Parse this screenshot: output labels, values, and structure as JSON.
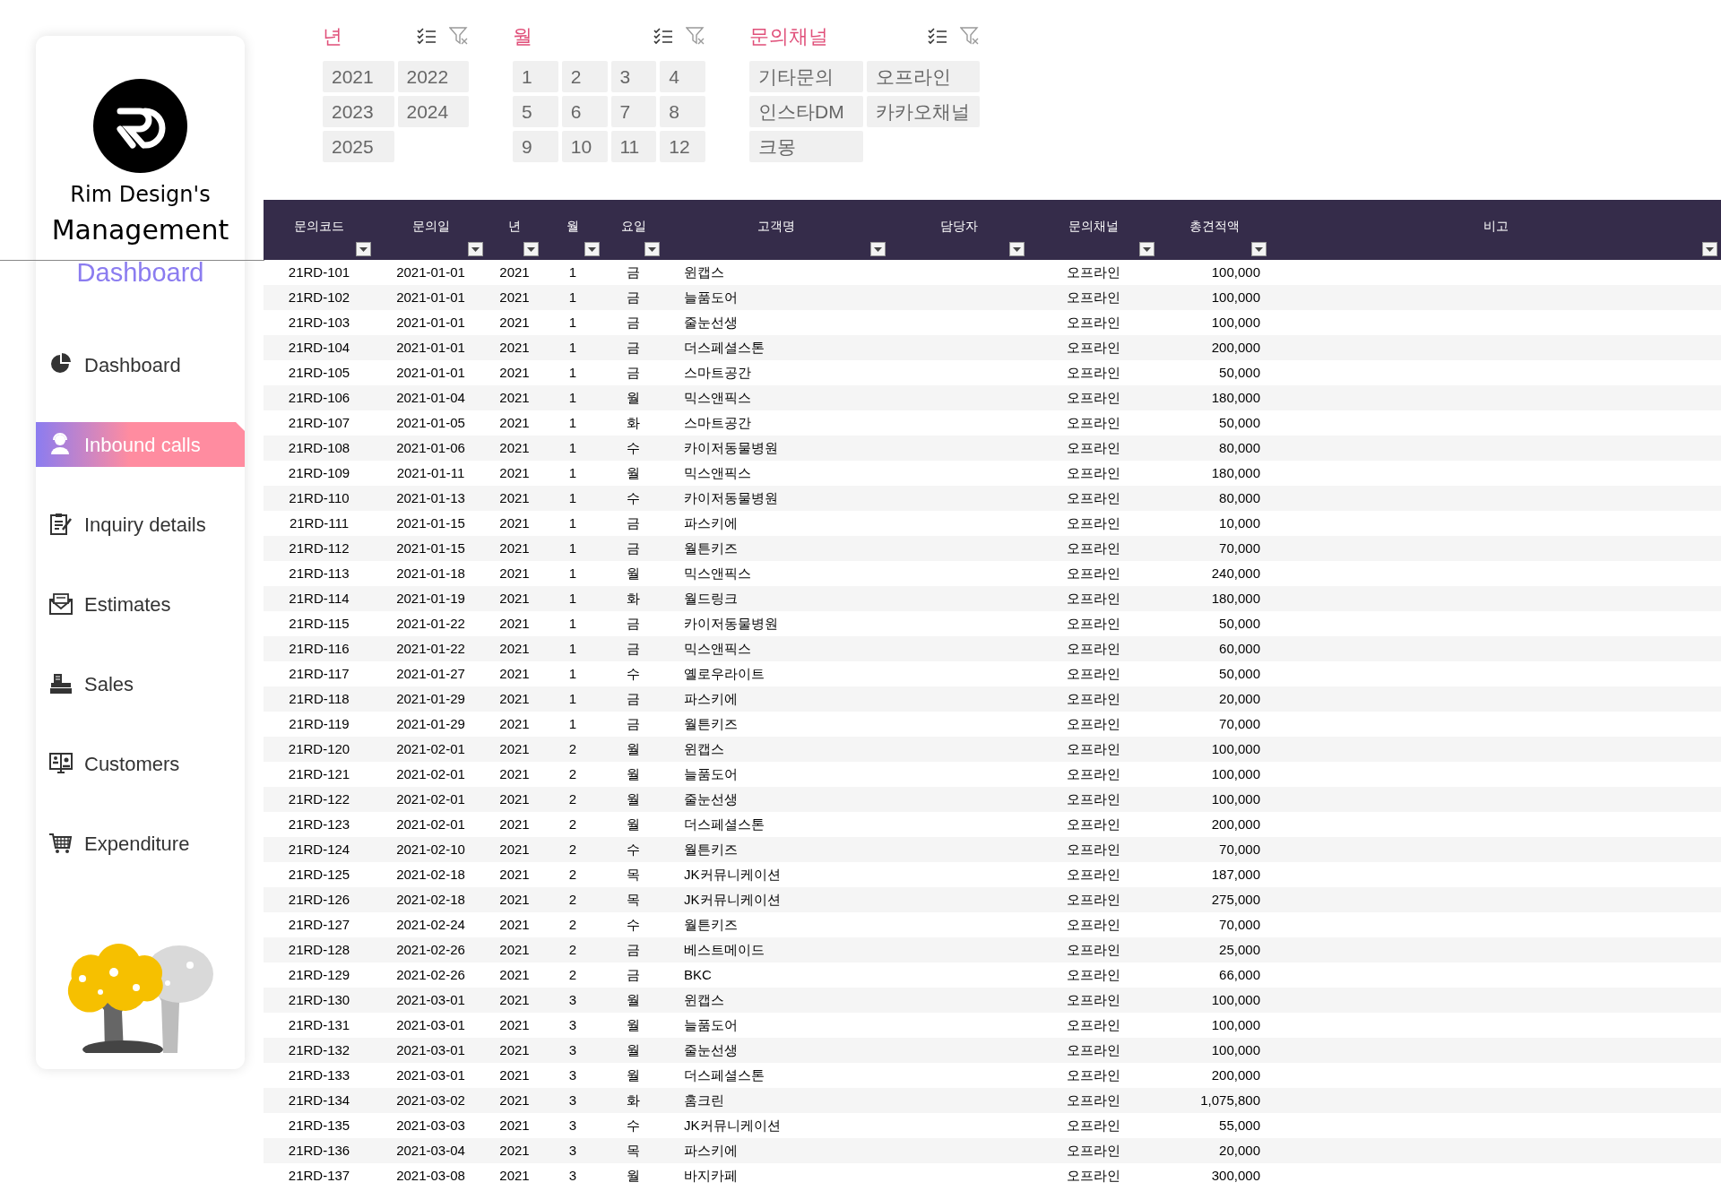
{
  "sidebar": {
    "brand": {
      "line1": "Rim Design's",
      "line2": "Management",
      "line3": "Dashboard"
    },
    "nav": [
      {
        "label": "Dashboard",
        "selected": false
      },
      {
        "label": "Inbound calls",
        "selected": true
      },
      {
        "label": "Inquiry details",
        "selected": false
      },
      {
        "label": "Estimates",
        "selected": false
      },
      {
        "label": "Sales",
        "selected": false
      },
      {
        "label": "Customers",
        "selected": false
      },
      {
        "label": "Expenditure",
        "selected": false
      }
    ]
  },
  "slicers": [
    {
      "title": "년",
      "items": [
        {
          "label": "2021",
          "selected": false
        },
        {
          "label": "2022",
          "selected": false
        },
        {
          "label": "2023",
          "selected": false
        },
        {
          "label": "2024",
          "selected": false
        },
        {
          "label": "2025",
          "selected": false
        }
      ]
    },
    {
      "title": "월",
      "items": [
        {
          "label": "1",
          "selected": false
        },
        {
          "label": "2",
          "selected": false
        },
        {
          "label": "3",
          "selected": false
        },
        {
          "label": "4",
          "selected": false
        },
        {
          "label": "5",
          "selected": false
        },
        {
          "label": "6",
          "selected": false
        },
        {
          "label": "7",
          "selected": false
        },
        {
          "label": "8",
          "selected": false
        },
        {
          "label": "9",
          "selected": false
        },
        {
          "label": "10",
          "selected": false
        },
        {
          "label": "11",
          "selected": false
        },
        {
          "label": "12",
          "selected": false
        }
      ]
    },
    {
      "title": "문의채널",
      "items": [
        {
          "label": "기타문의",
          "selected": false
        },
        {
          "label": "오프라인",
          "selected": false
        },
        {
          "label": "인스타DM",
          "selected": false
        },
        {
          "label": "카카오채널",
          "selected": false
        },
        {
          "label": "크몽",
          "selected": false
        }
      ]
    }
  ],
  "table": {
    "columns": [
      "문의코드",
      "문의일",
      "년",
      "월",
      "요일",
      "고객명",
      "담당자",
      "문의채널",
      "총견적액",
      "비고"
    ],
    "rows": [
      {
        "code": "21RD-101",
        "date": "2021-01-01",
        "year": "2021",
        "month": "1",
        "weekday": "금",
        "customer": "윈캡스",
        "channel": "오프라인",
        "amount": "100,000"
      },
      {
        "code": "21RD-102",
        "date": "2021-01-01",
        "year": "2021",
        "month": "1",
        "weekday": "금",
        "customer": "늘품도어",
        "channel": "오프라인",
        "amount": "100,000"
      },
      {
        "code": "21RD-103",
        "date": "2021-01-01",
        "year": "2021",
        "month": "1",
        "weekday": "금",
        "customer": "줄눈선생",
        "channel": "오프라인",
        "amount": "100,000"
      },
      {
        "code": "21RD-104",
        "date": "2021-01-01",
        "year": "2021",
        "month": "1",
        "weekday": "금",
        "customer": "더스페셜스톤",
        "channel": "오프라인",
        "amount": "200,000"
      },
      {
        "code": "21RD-105",
        "date": "2021-01-01",
        "year": "2021",
        "month": "1",
        "weekday": "금",
        "customer": "스마트공간",
        "channel": "오프라인",
        "amount": "50,000"
      },
      {
        "code": "21RD-106",
        "date": "2021-01-04",
        "year": "2021",
        "month": "1",
        "weekday": "월",
        "customer": "믹스앤픽스",
        "channel": "오프라인",
        "amount": "180,000"
      },
      {
        "code": "21RD-107",
        "date": "2021-01-05",
        "year": "2021",
        "month": "1",
        "weekday": "화",
        "customer": "스마트공간",
        "channel": "오프라인",
        "amount": "50,000"
      },
      {
        "code": "21RD-108",
        "date": "2021-01-06",
        "year": "2021",
        "month": "1",
        "weekday": "수",
        "customer": "카이저동물병원",
        "channel": "오프라인",
        "amount": "80,000"
      },
      {
        "code": "21RD-109",
        "date": "2021-01-11",
        "year": "2021",
        "month": "1",
        "weekday": "월",
        "customer": "믹스앤픽스",
        "channel": "오프라인",
        "amount": "180,000"
      },
      {
        "code": "21RD-110",
        "date": "2021-01-13",
        "year": "2021",
        "month": "1",
        "weekday": "수",
        "customer": "카이저동물병원",
        "channel": "오프라인",
        "amount": "80,000"
      },
      {
        "code": "21RD-111",
        "date": "2021-01-15",
        "year": "2021",
        "month": "1",
        "weekday": "금",
        "customer": "파스키에",
        "channel": "오프라인",
        "amount": "10,000"
      },
      {
        "code": "21RD-112",
        "date": "2021-01-15",
        "year": "2021",
        "month": "1",
        "weekday": "금",
        "customer": "월튼키즈",
        "channel": "오프라인",
        "amount": "70,000"
      },
      {
        "code": "21RD-113",
        "date": "2021-01-18",
        "year": "2021",
        "month": "1",
        "weekday": "월",
        "customer": "믹스앤픽스",
        "channel": "오프라인",
        "amount": "240,000"
      },
      {
        "code": "21RD-114",
        "date": "2021-01-19",
        "year": "2021",
        "month": "1",
        "weekday": "화",
        "customer": "월드링크",
        "channel": "오프라인",
        "amount": "180,000"
      },
      {
        "code": "21RD-115",
        "date": "2021-01-22",
        "year": "2021",
        "month": "1",
        "weekday": "금",
        "customer": "카이저동물병원",
        "channel": "오프라인",
        "amount": "50,000"
      },
      {
        "code": "21RD-116",
        "date": "2021-01-22",
        "year": "2021",
        "month": "1",
        "weekday": "금",
        "customer": "믹스앤픽스",
        "channel": "오프라인",
        "amount": "60,000"
      },
      {
        "code": "21RD-117",
        "date": "2021-01-27",
        "year": "2021",
        "month": "1",
        "weekday": "수",
        "customer": "옐로우라이트",
        "channel": "오프라인",
        "amount": "50,000"
      },
      {
        "code": "21RD-118",
        "date": "2021-01-29",
        "year": "2021",
        "month": "1",
        "weekday": "금",
        "customer": "파스키에",
        "channel": "오프라인",
        "amount": "20,000"
      },
      {
        "code": "21RD-119",
        "date": "2021-01-29",
        "year": "2021",
        "month": "1",
        "weekday": "금",
        "customer": "월튼키즈",
        "channel": "오프라인",
        "amount": "70,000"
      },
      {
        "code": "21RD-120",
        "date": "2021-02-01",
        "year": "2021",
        "month": "2",
        "weekday": "월",
        "customer": "윈캡스",
        "channel": "오프라인",
        "amount": "100,000"
      },
      {
        "code": "21RD-121",
        "date": "2021-02-01",
        "year": "2021",
        "month": "2",
        "weekday": "월",
        "customer": "늘품도어",
        "channel": "오프라인",
        "amount": "100,000"
      },
      {
        "code": "21RD-122",
        "date": "2021-02-01",
        "year": "2021",
        "month": "2",
        "weekday": "월",
        "customer": "줄눈선생",
        "channel": "오프라인",
        "amount": "100,000"
      },
      {
        "code": "21RD-123",
        "date": "2021-02-01",
        "year": "2021",
        "month": "2",
        "weekday": "월",
        "customer": "더스페셜스톤",
        "channel": "오프라인",
        "amount": "200,000"
      },
      {
        "code": "21RD-124",
        "date": "2021-02-10",
        "year": "2021",
        "month": "2",
        "weekday": "수",
        "customer": "월튼키즈",
        "channel": "오프라인",
        "amount": "70,000"
      },
      {
        "code": "21RD-125",
        "date": "2021-02-18",
        "year": "2021",
        "month": "2",
        "weekday": "목",
        "customer": "JK커뮤니케이션",
        "channel": "오프라인",
        "amount": "187,000"
      },
      {
        "code": "21RD-126",
        "date": "2021-02-18",
        "year": "2021",
        "month": "2",
        "weekday": "목",
        "customer": "JK커뮤니케이션",
        "channel": "오프라인",
        "amount": "275,000"
      },
      {
        "code": "21RD-127",
        "date": "2021-02-24",
        "year": "2021",
        "month": "2",
        "weekday": "수",
        "customer": "월튼키즈",
        "channel": "오프라인",
        "amount": "70,000"
      },
      {
        "code": "21RD-128",
        "date": "2021-02-26",
        "year": "2021",
        "month": "2",
        "weekday": "금",
        "customer": "베스트메이드",
        "channel": "오프라인",
        "amount": "25,000"
      },
      {
        "code": "21RD-129",
        "date": "2021-02-26",
        "year": "2021",
        "month": "2",
        "weekday": "금",
        "customer": "BKC",
        "channel": "오프라인",
        "amount": "66,000"
      },
      {
        "code": "21RD-130",
        "date": "2021-03-01",
        "year": "2021",
        "month": "3",
        "weekday": "월",
        "customer": "윈캡스",
        "channel": "오프라인",
        "amount": "100,000"
      },
      {
        "code": "21RD-131",
        "date": "2021-03-01",
        "year": "2021",
        "month": "3",
        "weekday": "월",
        "customer": "늘품도어",
        "channel": "오프라인",
        "amount": "100,000"
      },
      {
        "code": "21RD-132",
        "date": "2021-03-01",
        "year": "2021",
        "month": "3",
        "weekday": "월",
        "customer": "줄눈선생",
        "channel": "오프라인",
        "amount": "100,000"
      },
      {
        "code": "21RD-133",
        "date": "2021-03-01",
        "year": "2021",
        "month": "3",
        "weekday": "월",
        "customer": "더스페셜스톤",
        "channel": "오프라인",
        "amount": "200,000"
      },
      {
        "code": "21RD-134",
        "date": "2021-03-02",
        "year": "2021",
        "month": "3",
        "weekday": "화",
        "customer": "홈크린",
        "channel": "오프라인",
        "amount": "1,075,800"
      },
      {
        "code": "21RD-135",
        "date": "2021-03-03",
        "year": "2021",
        "month": "3",
        "weekday": "수",
        "customer": "JK커뮤니케이션",
        "channel": "오프라인",
        "amount": "55,000"
      },
      {
        "code": "21RD-136",
        "date": "2021-03-04",
        "year": "2021",
        "month": "3",
        "weekday": "목",
        "customer": "파스키에",
        "channel": "오프라인",
        "amount": "20,000"
      },
      {
        "code": "21RD-137",
        "date": "2021-03-08",
        "year": "2021",
        "month": "3",
        "weekday": "월",
        "customer": "바지카페",
        "channel": "오프라인",
        "amount": "300,000"
      }
    ]
  }
}
